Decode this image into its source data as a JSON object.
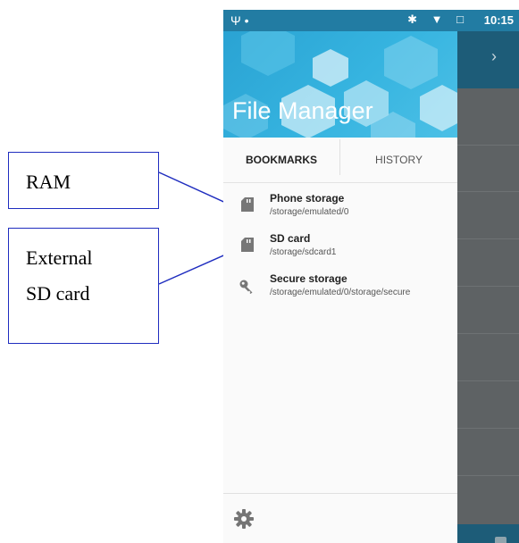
{
  "annotations": {
    "ram_label": "RAM",
    "sd_label_line1": "External",
    "sd_label_line2": "SD card"
  },
  "status_bar": {
    "left_icons": "Ψ •",
    "right_icons": "✱ ▼ □",
    "time": "10:15"
  },
  "drawer": {
    "title": "File Manager",
    "tabs": [
      {
        "label": "BOOKMARKS",
        "active": true
      },
      {
        "label": "HISTORY",
        "active": false
      }
    ],
    "items": [
      {
        "name": "Phone storage",
        "path": "/storage/emulated/0",
        "icon": "sd-card-icon"
      },
      {
        "name": "SD card",
        "path": "/storage/sdcard1",
        "icon": "sd-card-icon"
      },
      {
        "name": "Secure storage",
        "path": "/storage/emulated/0/storage/secure",
        "icon": "key-icon"
      }
    ],
    "footer_icon": "gear-icon"
  },
  "background_app": {
    "toolbar_icon": "chevron-right-icon",
    "bottom_icon": "search-icon"
  },
  "colors": {
    "accent": "#227ca3",
    "header": "#36b4e0",
    "callout_border": "#1f2dbf"
  }
}
